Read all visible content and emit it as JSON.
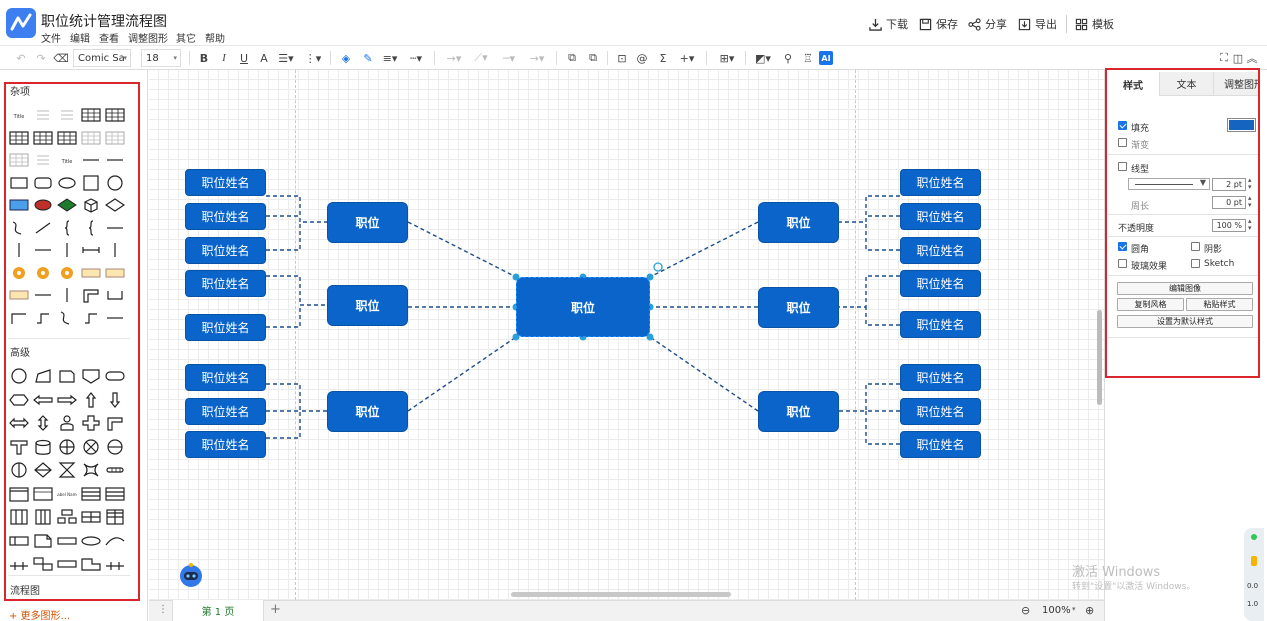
{
  "app": {
    "title": "职位统计管理流程图"
  },
  "menu": [
    "文件",
    "编辑",
    "查看",
    "调整图形",
    "其它",
    "帮助"
  ],
  "header_actions": [
    {
      "label": "下载",
      "icon": "download-icon"
    },
    {
      "label": "保存",
      "icon": "save-icon"
    },
    {
      "label": "分享",
      "icon": "share-icon"
    },
    {
      "label": "导出",
      "icon": "export-icon"
    },
    {
      "label": "模板",
      "icon": "template-icon"
    }
  ],
  "toolbar": {
    "font": "Comic Sa",
    "font_size": "18",
    "ai_label": "AI"
  },
  "left_panel": {
    "section_misc": "杂项",
    "section_advanced": "高级",
    "section_flowchart": "流程图",
    "more_shapes": "+ 更多图形..."
  },
  "diagram": {
    "center": "职位",
    "mid_label": "职位",
    "leaf_label": "职位姓名"
  },
  "bottom": {
    "page_tab": "第 1 页",
    "zoom": "100%"
  },
  "right_panel": {
    "tabs": [
      "样式",
      "文本",
      "调整图形"
    ],
    "fill": "填充",
    "gradient": "渐变",
    "line": "线型",
    "line_width": "2 pt",
    "perimeter": "周长",
    "perimeter_value": "0 pt",
    "opacity": "不透明度",
    "opacity_value": "100 %",
    "rounded": "圆角",
    "shadow": "阴影",
    "glass": "玻璃效果",
    "sketch": "Sketch",
    "edit_style": "编辑图像",
    "copy_style": "复制风格",
    "paste_style": "粘贴样式",
    "set_default": "设置为默认样式",
    "fill_color": "#1565c0"
  },
  "watermark": {
    "line1": "激活 Windows",
    "line2": "转到\"设置\"以激活 Windows。"
  },
  "speed_widget": {
    "v1": "0.0",
    "v2": "1.0"
  }
}
